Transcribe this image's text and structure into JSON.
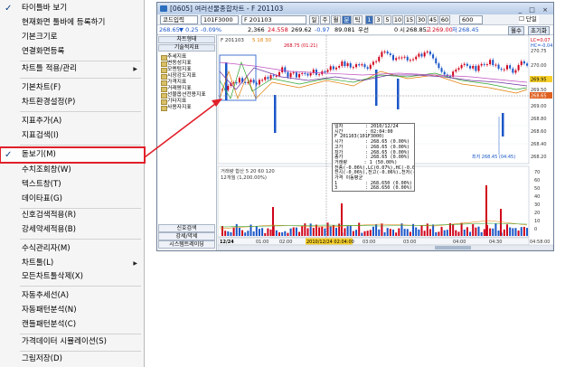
{
  "menu": {
    "items": [
      {
        "label": "타이틀바 보기",
        "submenu": false,
        "checked": true
      },
      {
        "label": "현재화면 툴바에 등록하기",
        "submenu": false,
        "checked": false
      },
      {
        "label": "기본크기로",
        "submenu": false,
        "checked": false
      },
      {
        "label": "연결화면등록",
        "submenu": false,
        "checked": false
      },
      {
        "label": "차트틀 적용/관리",
        "submenu": true,
        "checked": false
      },
      {
        "label": "기본차트(F)",
        "submenu": false,
        "checked": false
      },
      {
        "label": "차트환경설정(P)",
        "submenu": false,
        "checked": false
      },
      {
        "label": "지표추가(A)",
        "submenu": false,
        "checked": false
      },
      {
        "label": "지표검색(I)",
        "submenu": false,
        "checked": false
      },
      {
        "label": "돋보기(M)",
        "submenu": false,
        "checked": true,
        "highlighted": true
      },
      {
        "label": "수치조회창(W)",
        "submenu": false,
        "checked": false
      },
      {
        "label": "텍스트창(T)",
        "submenu": false,
        "checked": false
      },
      {
        "label": "데이타표(G)",
        "submenu": false,
        "checked": false
      },
      {
        "label": "신호검색적용(R)",
        "submenu": false,
        "checked": false
      },
      {
        "label": "강세약세적용(B)",
        "submenu": false,
        "checked": false
      },
      {
        "label": "수식관리자(M)",
        "submenu": false,
        "checked": false
      },
      {
        "label": "차트툴(L)",
        "submenu": true,
        "checked": false
      },
      {
        "label": "모든차트툴삭제(X)",
        "submenu": false,
        "checked": false
      },
      {
        "label": "자동추세선(A)",
        "submenu": false,
        "checked": false
      },
      {
        "label": "자동패턴분석(N)",
        "submenu": false,
        "checked": false
      },
      {
        "label": "캔들패턴분석(C)",
        "submenu": false,
        "checked": false
      },
      {
        "label": "가격데이터 시뮬레이션(S)",
        "submenu": false,
        "checked": false
      },
      {
        "label": "그림저장(D)",
        "submenu": false,
        "checked": false
      }
    ],
    "check_glyph": "✓",
    "arrow_glyph": "▶",
    "highlight_color": "#e0202a"
  },
  "window": {
    "title": "[0605] 여러선물종합차트 - F 201103",
    "controls": "_ □ ×",
    "toolbar": {
      "combo_text": "코드입력",
      "code": "101F3000",
      "name": "F 201103",
      "units": [
        "1",
        "3",
        "5",
        "10",
        "15",
        "30",
        "45",
        "60"
      ],
      "active_unit": "1",
      "count": "600",
      "period_tabs": [
        "일",
        "주",
        "월",
        "분",
        "틱"
      ],
      "active_period": "분",
      "single_label": "단일"
    },
    "infobar": {
      "price": "268.65",
      "change": "▼ 0.25",
      "change_pct": "-0.09%",
      "volume": "2,366",
      "ratio": "24.558",
      "high": "269.62",
      "low": "-0.97",
      "basis": "89.081",
      "label": "우선",
      "open": "0",
      "open_label": "시",
      "v1": "268.85",
      "v1_label": "고",
      "v2": "269.00",
      "v2_label": "저",
      "v3": "268.45",
      "mode_label": "월수",
      "reset_label": "초기화"
    },
    "leftpane": {
      "head1": "차트형태",
      "head2": "기술적지표",
      "items": [
        "추세지표",
        "변동성지표",
        "모멘텀지표",
        "시장강도지표",
        "가격지표",
        "거래량지표",
        "선물옵션전용지표",
        "기타지표",
        "사용자지표"
      ],
      "bottom": [
        "신호검색",
        "강세/약세",
        "시스템트레이딩"
      ]
    },
    "chart": {
      "price_legend": "F 201103",
      "legend_extra": "5  18  30",
      "annotation_top": "268.75 (01:21)",
      "annotation_low": "최저 268.45 (04:45)",
      "right_labels": [
        "LC=0.07",
        "HC=-0.04",
        "270.75",
        "269.95",
        "269.70",
        "269.45",
        "268.65",
        "268.60",
        "268.50",
        "268.45"
      ],
      "right_axis": [
        "270.00",
        "269.50",
        "269.00",
        "268.80",
        "268.60",
        "268.40",
        "268.20"
      ],
      "volume_legend": "거래량  합산 5  20  60  120",
      "volume_sub": "12개월 (1,200.00%)",
      "volume_axis": [
        "70",
        "60",
        "50",
        "40",
        "30",
        "20",
        "10",
        "0"
      ],
      "time_axis": [
        "12/24",
        "01:00",
        "02:00",
        "02:00",
        "03:00",
        "03:00",
        "04:00",
        "04:30",
        "04:58:00"
      ],
      "time_highlight": "2010/12/24 02:04:00",
      "colors": {
        "up": "#d0021b",
        "down": "#1a56c8",
        "ma5": "#e07c00",
        "ma18": "#2fa52f",
        "ma30": "#7030a0",
        "ma60": "#c050c0"
      }
    },
    "tooltip": "일자        : 2010/12/24\n시간        : 02:04:00\nF 201103(101F3000)\n시가        : 268.65 (0.00%)\n고가        : 268.65 (0.00%)\n저가        : 268.65 (0.00%)\n종가        : 268.65 (0.00%)\n거래량      : 1 (50.00%)\n전종(-0.06%),LC(0.07%),HC(-0.04%)\n전시(-0.06%),전고(-0.06%),전저(-0.06%)\n가격 이동평균\n1          : 268.650 (0.00%)\n3          : 268.650 (0.00%)\n5          : 268.630 (-0.01%)\n10         : 268.625 (-0.01%)\n30         : 268.625 (-0.01%)"
  }
}
